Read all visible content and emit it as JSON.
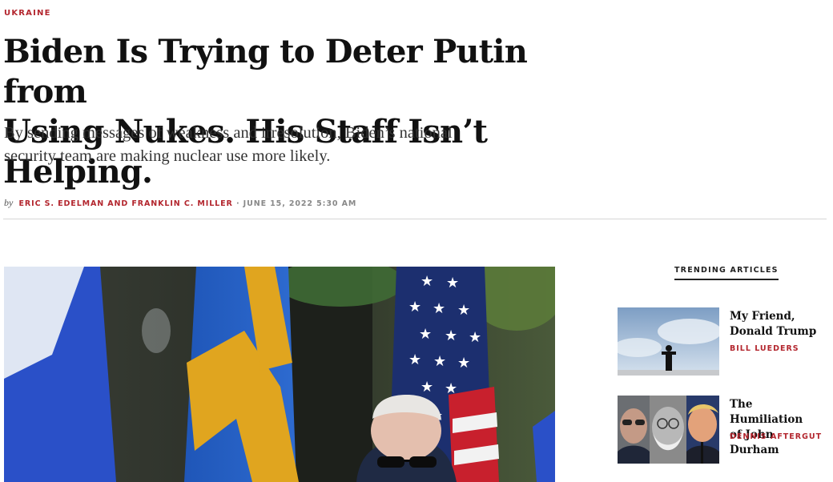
{
  "article": {
    "kicker": "UKRAINE",
    "headline_line1": "Biden Is Trying to Deter Putin from",
    "headline_line2": "Using Nukes. His Staff Isn’t Helping.",
    "dek_line1": "By sending messages of weakness and irresolution, Biden’s national",
    "dek_line2": "security team are making nuclear use more likely.",
    "byline": {
      "by": "by",
      "authors": "ERIC S. EDELMAN AND FRANKLIN C. MILLER",
      "separator": "·",
      "date": "JUNE 15, 2022 5:30 AM"
    }
  },
  "trending": {
    "title": "TRENDING ARTICLES",
    "items": [
      {
        "title_line1": "My Friend,",
        "title_line2": "Donald Trump",
        "author": "BILL LUEDERS"
      },
      {
        "title_line1": "The Humiliation",
        "title_line2": "of John Durham",
        "author": "DENNIS AFTERGUT"
      }
    ]
  },
  "colors": {
    "accent": "#b3262e",
    "text": "#111111",
    "rule": "#d6d6d6"
  }
}
